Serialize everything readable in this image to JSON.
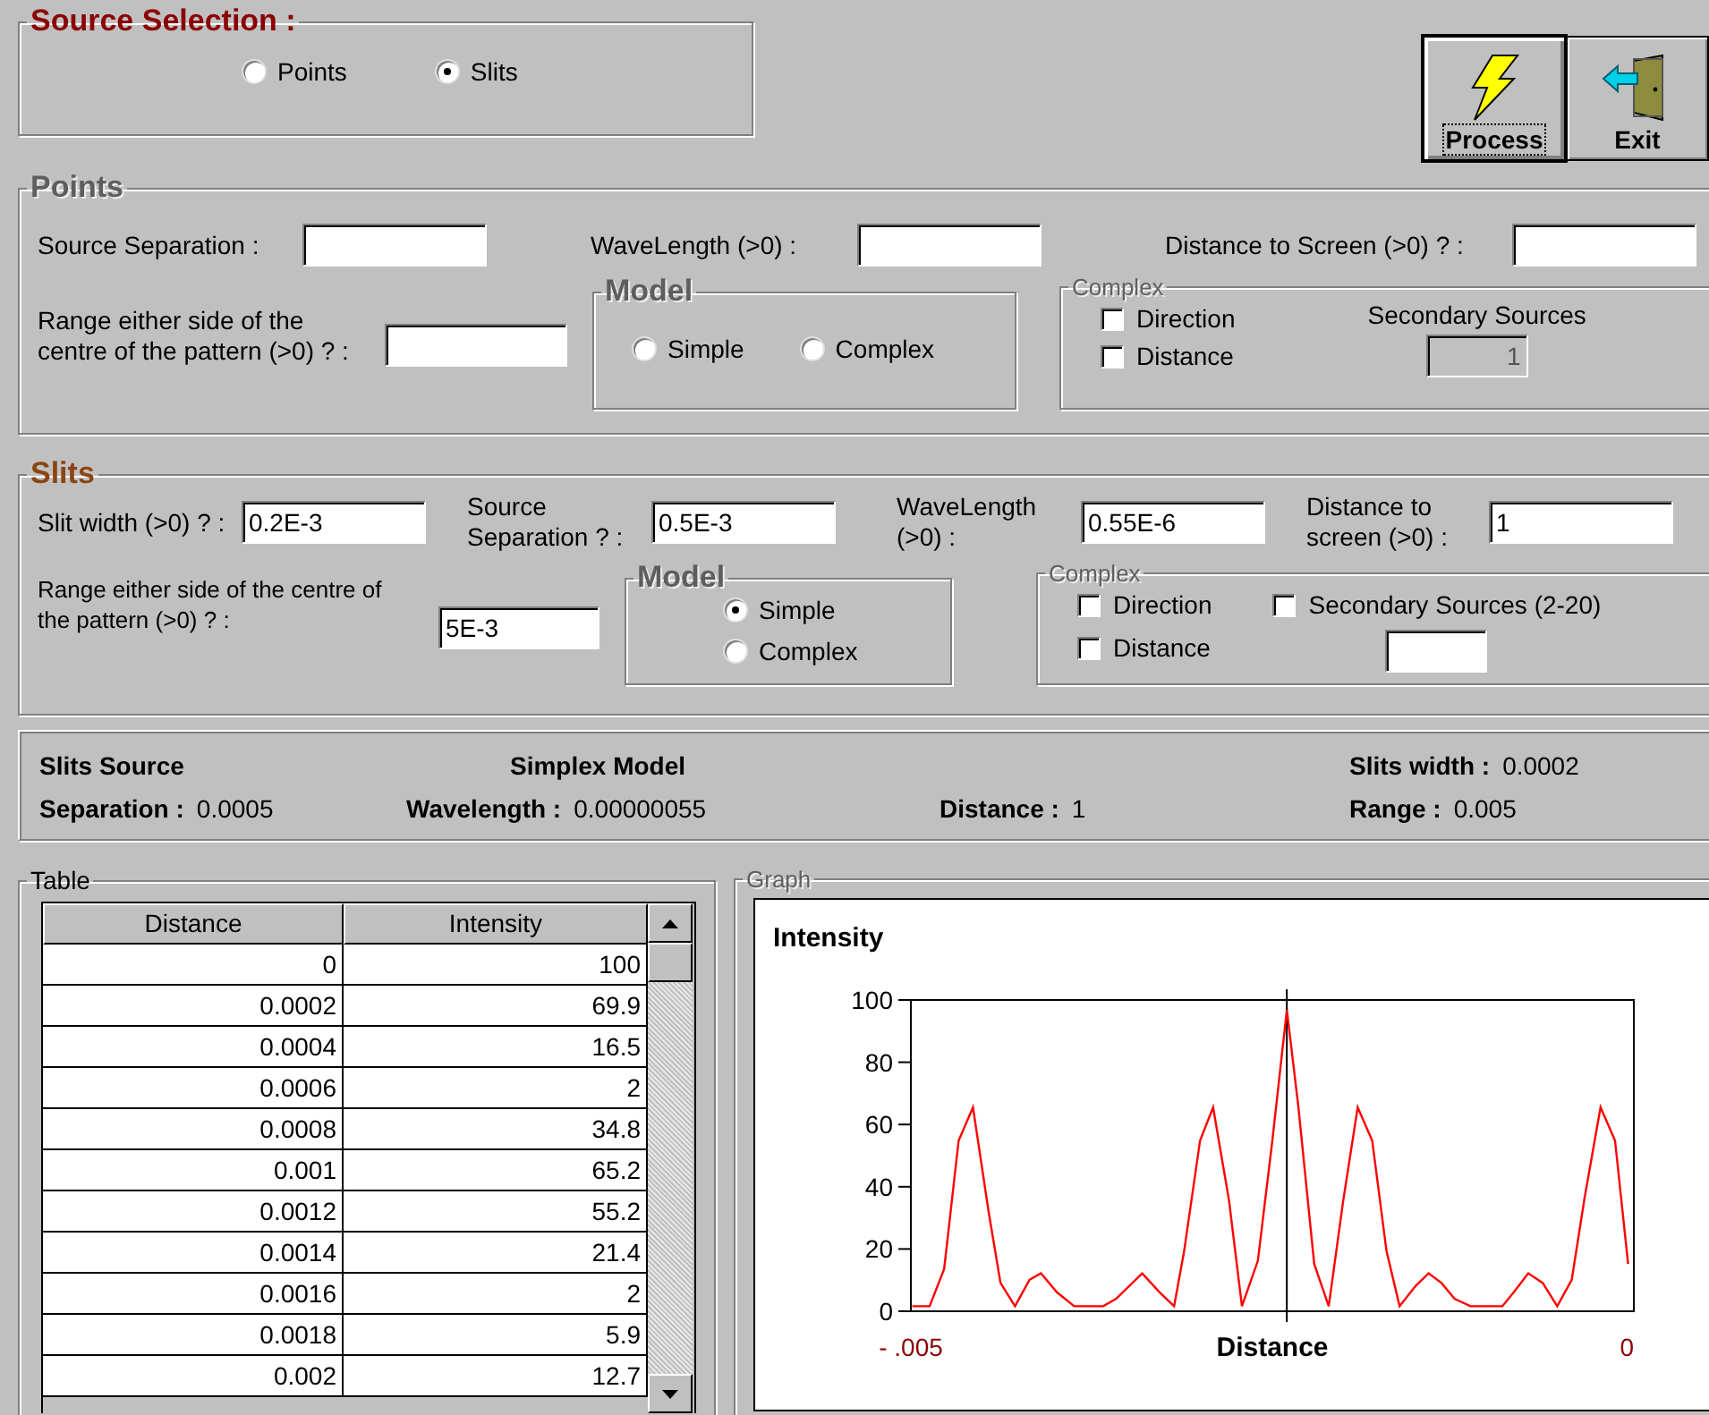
{
  "source_selection": {
    "title": "Source Selection :",
    "options": [
      {
        "label": "Points",
        "selected": false
      },
      {
        "label": "Slits",
        "selected": true
      }
    ]
  },
  "toolbar": [
    {
      "label": "Process",
      "kind": "process",
      "focused": true
    },
    {
      "label": "Exit",
      "kind": "exit",
      "focused": false
    }
  ],
  "points": {
    "title": "Points",
    "disabled": true,
    "fields": [
      {
        "label": "Source Separation :"
      },
      {
        "label": "WaveLength (>0) :"
      },
      {
        "label": "Distance to Screen (>0) ? :"
      }
    ],
    "range": {
      "label": "Range either side of the\ncentre of the pattern (>0) ? :"
    },
    "model": {
      "title": "Model",
      "options": [
        {
          "label": "Simple",
          "selected": false
        },
        {
          "label": "Complex",
          "selected": false
        }
      ]
    },
    "complex": {
      "title": "Complex",
      "disabled": true,
      "checks": [
        {
          "label": "Direction",
          "checked": false
        },
        {
          "label": "Distance",
          "checked": false
        }
      ],
      "secondary": {
        "label": "Secondary Sources",
        "value": "1",
        "disabled": true
      }
    }
  },
  "slits": {
    "title": "Slits",
    "disabled": false,
    "fields": [
      {
        "label": "Slit width (>0) ? :",
        "value": "0.2E-3"
      },
      {
        "label": "Source\nSeparation ? :",
        "value": "0.5E-3"
      },
      {
        "label": "WaveLength\n(>0) :",
        "value": "0.55E-6"
      },
      {
        "label": "Distance to\nscreen (>0) :",
        "value": "1"
      }
    ],
    "range": {
      "label": "Range either side of the centre of\nthe pattern (>0) ? :",
      "value": "5E-3"
    },
    "model": {
      "title": "Model",
      "options": [
        {
          "label": "Simple",
          "selected": true
        },
        {
          "label": "Complex",
          "selected": false
        }
      ]
    },
    "complex": {
      "title": "Complex",
      "disabled": true,
      "checks": [
        {
          "label": "Direction",
          "checked": false
        },
        {
          "label": "Distance",
          "checked": false
        }
      ],
      "secondary": {
        "label": "Secondary Sources (2-20)",
        "checked": false,
        "disabled": false
      }
    }
  },
  "summary": {
    "rows": [
      [
        {
          "label": "Slits Source"
        },
        {
          "label": "Simplex Model"
        },
        "",
        {
          "label": "Slits width :",
          "value": "0.0002"
        }
      ],
      [
        {
          "label": "Separation :",
          "value": "0.0005"
        },
        {
          "label": "Wavelength :",
          "value": "0.00000055"
        },
        {
          "label": "Distance :",
          "value": "1"
        },
        {
          "label": "Range :",
          "value": "0.005"
        }
      ]
    ]
  },
  "table": {
    "title": "Table",
    "columns": [
      "Distance",
      "Intensity"
    ],
    "rows": [
      [
        "0",
        "100"
      ],
      [
        "0.0002",
        "69.9"
      ],
      [
        "0.0004",
        "16.5"
      ],
      [
        "0.0006",
        "2"
      ],
      [
        "0.0008",
        "34.8"
      ],
      [
        "0.001",
        "65.2"
      ],
      [
        "0.0012",
        "55.2"
      ],
      [
        "0.0014",
        "21.4"
      ],
      [
        "0.0016",
        "2"
      ],
      [
        "0.0018",
        "5.9"
      ],
      [
        "0.002",
        "12.7"
      ]
    ]
  },
  "graph": {
    "title": "Graph",
    "chart_data": {
      "type": "line",
      "ylabel": "Intensity",
      "xlabel": "Distance",
      "xlim": [
        -0.005,
        0
      ],
      "ylim": [
        0,
        100
      ],
      "xticks": [
        {
          "value": -0.005,
          "label": "- .005"
        },
        {
          "value": 0,
          "label": "0"
        }
      ],
      "yticks": [
        0,
        20,
        40,
        60,
        80,
        100
      ],
      "ref_lines": [
        {
          "axis": "x",
          "value": -0.0024,
          "color": "#000000"
        }
      ],
      "x": [
        -0.00499,
        -0.00487,
        -0.00477,
        -0.00467,
        -0.00457,
        -0.00446,
        -0.00438,
        -0.00428,
        -0.00418,
        -0.0041,
        -0.00399,
        -0.00387,
        -0.00367,
        -0.00358,
        -0.0034,
        -0.00328,
        -0.00318,
        -0.00311,
        -0.003,
        -0.00291,
        -0.0028,
        -0.00271,
        -0.0026,
        -0.0025,
        -0.0024,
        -0.00232,
        -0.00221,
        -0.00211,
        -0.00201,
        -0.00191,
        -0.00181,
        -0.00171,
        -0.00162,
        -0.00151,
        -0.00142,
        -0.00133,
        -0.00124,
        -0.00113,
        -0.00091,
        -0.00083,
        -0.00073,
        -0.00063,
        -0.00053,
        -0.00043,
        -0.00034,
        -0.00023,
        -0.00013,
        -4e-05
      ],
      "series": [
        {
          "color": "#ff0000",
          "values": [
            1.6,
            1.6,
            13.6,
            54.8,
            65.5,
            31.4,
            9.1,
            1.6,
            10.1,
            12.2,
            6.1,
            1.6,
            1.6,
            4,
            12.2,
            6.1,
            1.6,
            19.3,
            54.8,
            65.5,
            35.5,
            1.6,
            16.2,
            54.8,
            96.8,
            65.9,
            15.2,
            1.6,
            35.5,
            65.5,
            54.8,
            19.3,
            1.6,
            8.1,
            12.2,
            9.1,
            4,
            1.6,
            1.6,
            6.1,
            12.2,
            9.1,
            1.6,
            10.1,
            36.5,
            65.5,
            54.8,
            15.2
          ]
        }
      ]
    }
  }
}
